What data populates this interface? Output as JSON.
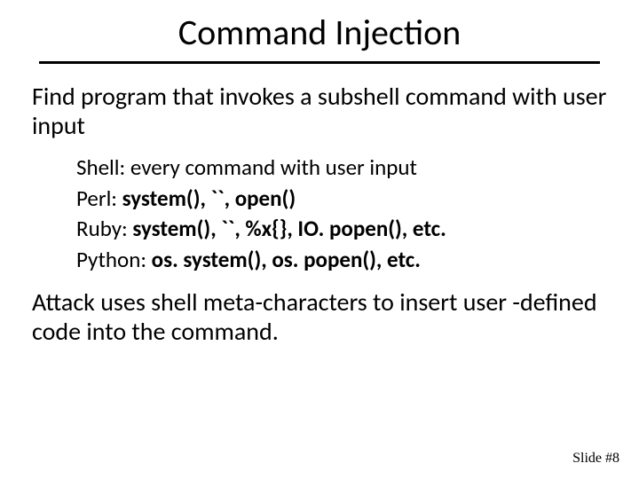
{
  "title": "Command Injection",
  "lead": "Find program that invokes a subshell command with user input",
  "items": [
    {
      "label": "Shell: ",
      "value": "every command with user input",
      "bold": false
    },
    {
      "label": "Perl: ",
      "value": "system(), ``, open()",
      "bold": true
    },
    {
      "label": "Ruby: ",
      "value": "system(), ``, %x{}, IO. popen(), etc.",
      "bold": true
    },
    {
      "label": "Python: ",
      "value": "os. system(), os. popen(), etc.",
      "bold": true
    }
  ],
  "closing": "Attack uses shell meta-characters to insert user -defined code into the command.",
  "footer": "Slide #8"
}
